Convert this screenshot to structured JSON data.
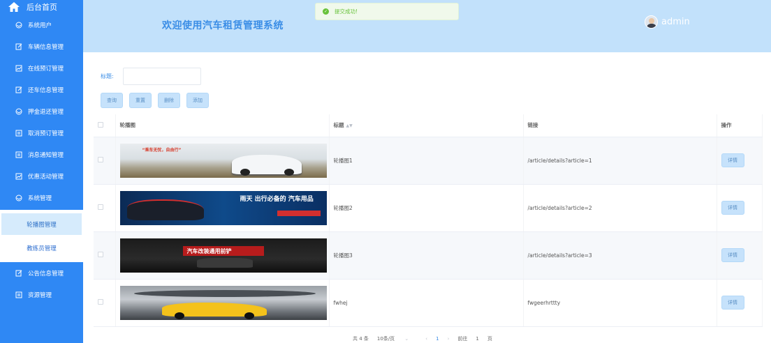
{
  "sidebar": {
    "home": "后台首页",
    "items_top": [
      {
        "label": "系统用户",
        "icon": "user-icon"
      },
      {
        "label": "车辆信息管理",
        "icon": "edit-icon"
      },
      {
        "label": "在线预订管理",
        "icon": "chart-icon"
      },
      {
        "label": "还车信息管理",
        "icon": "edit-icon"
      },
      {
        "label": "押金退还管理",
        "icon": "user-icon"
      },
      {
        "label": "取消预订管理",
        "icon": "document-icon"
      },
      {
        "label": "消息通知管理",
        "icon": "document-icon"
      },
      {
        "label": "优惠活动管理",
        "icon": "chart-icon"
      },
      {
        "label": "系统管理",
        "icon": "user-icon"
      }
    ],
    "sub_items": [
      {
        "label": "轮播图管理"
      },
      {
        "label": "教练员管理"
      }
    ],
    "items_bottom": [
      {
        "label": "公告信息管理",
        "icon": "edit-icon"
      },
      {
        "label": "资源管理",
        "icon": "document-icon"
      }
    ]
  },
  "header": {
    "title": "欢迎使用汽车租赁管理系统",
    "user": "admin"
  },
  "toast": {
    "message": "提交成功!"
  },
  "search": {
    "label": "标题:",
    "value": "",
    "placeholder": ""
  },
  "buttons": {
    "query": "查询",
    "reset": "重置",
    "delete": "删除",
    "add": "添加"
  },
  "table": {
    "columns": [
      "轮播图",
      "标题",
      "链接",
      "操作"
    ],
    "rows": [
      {
        "banner_text": "“乘车无忧，自由行”",
        "title": "轮播图1",
        "link": "/article/details?article=1",
        "action": "详情"
      },
      {
        "banner_text": "雨天 出行必备的 汽车用品",
        "title": "轮播图2",
        "link": "/article/details?article=2",
        "action": "详情"
      },
      {
        "banner_text": "汽车改装通用前铲",
        "title": "轮播图3",
        "link": "/article/details?article=3",
        "action": "详情"
      },
      {
        "banner_text": "",
        "title": "fwhej",
        "link": "fwgeerhrttty",
        "action": "详情"
      }
    ]
  },
  "pagination": {
    "total": "共 4 条",
    "page_size": "10条/页",
    "current": "1",
    "goto_label": "前往",
    "goto_value": "1",
    "page_unit": "页"
  },
  "colors": {
    "sidebar": "#2f88f4",
    "header": "#c2e1fb",
    "accent": "#3a8de6",
    "button_bg": "#c6e2fb",
    "success": "#67c23a"
  }
}
